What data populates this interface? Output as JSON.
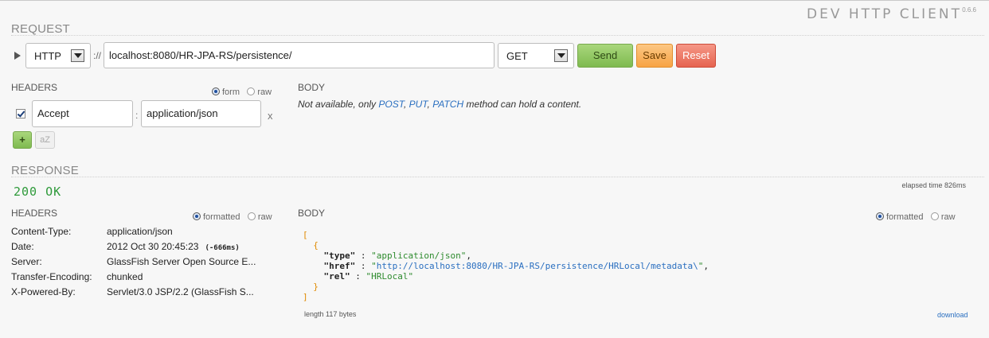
{
  "app": {
    "title": "DEV HTTP CLIENT",
    "version": "0.6.6"
  },
  "request": {
    "section_title": "REQUEST",
    "scheme": "HTTP",
    "scheme_sep": "://",
    "url": "localhost:8080/HR-JPA-RS/persistence/",
    "method": "GET",
    "buttons": {
      "send": "Send",
      "save": "Save",
      "reset": "Reset"
    },
    "headers_label": "HEADERS",
    "headers_mode": {
      "form": "form",
      "raw": "raw",
      "selected": "form"
    },
    "header_rows": [
      {
        "enabled": true,
        "name": "Accept",
        "value": "application/json"
      }
    ],
    "header_sep": ":",
    "remove_label": "x",
    "add_label": "+",
    "sort_label": "aZ",
    "body_label": "BODY",
    "body_note": {
      "prefix": "Not available, only ",
      "m1": "POST",
      "c1": ", ",
      "m2": "PUT",
      "c2": ", ",
      "m3": "PATCH",
      "suffix": " method can hold a content."
    }
  },
  "response": {
    "section_title": "RESPONSE",
    "status": "200 OK",
    "elapsed": "elapsed time 826ms",
    "headers_label": "HEADERS",
    "headers_mode": {
      "formatted": "formatted",
      "raw": "raw",
      "selected": "formatted"
    },
    "headers": [
      {
        "name": "Content-Type:",
        "value": "application/json",
        "extra": ""
      },
      {
        "name": "Date:",
        "value": "2012 Oct 30 20:45:23",
        "extra": "(-666ms)"
      },
      {
        "name": "Server:",
        "value": "GlassFish Server Open Source E...",
        "extra": ""
      },
      {
        "name": "Transfer-Encoding:",
        "value": "chunked",
        "extra": ""
      },
      {
        "name": "X-Powered-By:",
        "value": "Servlet/3.0 JSP/2.2 (GlassFish S...",
        "extra": ""
      }
    ],
    "body_label": "BODY",
    "body_mode": {
      "formatted": "formatted",
      "raw": "raw",
      "selected": "formatted"
    },
    "body_json": {
      "open_array": "[",
      "open_obj": "{",
      "k_type": "\"type\"",
      "v_type": "\"application/json\"",
      "k_href": "\"href\"",
      "v_href_q1": "\"",
      "v_href_link": "http://localhost:8080/HR-JPA-RS/persistence/HRLocal/metadata\\",
      "v_href_q2": "\"",
      "k_rel": "\"rel\"",
      "v_rel": "\"HRLocal\"",
      "colon": " : ",
      "comma": ",",
      "close_obj": "}",
      "close_array": "]"
    },
    "length": "length 117 bytes",
    "download": "download"
  },
  "colors": {
    "send": "#8cc660",
    "save": "#f9b25c",
    "reset": "#ea725f",
    "status_ok": "#2e9a3a",
    "link": "#2a6fc0"
  }
}
